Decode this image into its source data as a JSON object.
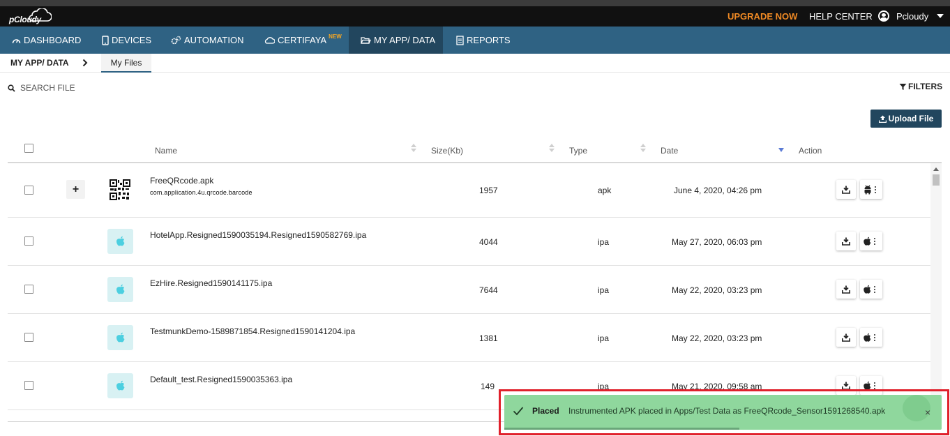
{
  "header": {
    "logo_text": "pCloudy",
    "upgrade_label": "UPGRADE NOW",
    "help_label": "HELP CENTER",
    "user_name": "Pcloudy"
  },
  "nav": {
    "items": [
      {
        "label": "DASHBOARD",
        "icon": "speedometer-icon"
      },
      {
        "label": "DEVICES",
        "icon": "mobile-icon"
      },
      {
        "label": "AUTOMATION",
        "icon": "gears-icon"
      },
      {
        "label": "CERTIFAYA",
        "icon": "cloud-cog-icon",
        "badge": "NEW"
      },
      {
        "label": "MY APP/ DATA",
        "icon": "folder-open-icon",
        "active": true
      },
      {
        "label": "REPORTS",
        "icon": "document-icon"
      }
    ]
  },
  "subbar": {
    "title": "MY APP/ DATA",
    "tab_label": "My Files"
  },
  "toolbar": {
    "search_label": "SEARCH FILE",
    "filters_label": "FILTERS",
    "upload_label": "Upload File"
  },
  "table": {
    "columns": {
      "name": "Name",
      "size": "Size(Kb)",
      "type": "Type",
      "date": "Date",
      "action": "Action"
    },
    "rows": [
      {
        "name": "FreeQRcode.apk",
        "package": "com.application.4u.qrcode.barcode",
        "size": "1957",
        "type": "apk",
        "date": "June 4, 2020, 04:26 pm",
        "platform": "android"
      },
      {
        "name": "HotelApp.Resigned1590035194.Resigned1590582769.ipa",
        "size": "4044",
        "type": "ipa",
        "date": "May 27, 2020, 06:03 pm",
        "platform": "ios"
      },
      {
        "name": "EzHire.Resigned1590141175.ipa",
        "size": "7644",
        "type": "ipa",
        "date": "May 22, 2020, 03:23 pm",
        "platform": "ios"
      },
      {
        "name": "TestmunkDemo-1589871854.Resigned1590141204.ipa",
        "size": "1381",
        "type": "ipa",
        "date": "May 22, 2020, 03:23 pm",
        "platform": "ios"
      },
      {
        "name": "Default_test.Resigned1590035363.ipa",
        "size": "149",
        "type": "ipa",
        "date": "May 21, 2020, 09:58 am",
        "platform": "ios"
      }
    ]
  },
  "toast": {
    "title": "Placed",
    "message": "Instrumented APK placed in Apps/Test Data as FreeQRcode_Sensor1591268540.apk",
    "close_label": "×",
    "color": "#8fd79d"
  },
  "colors": {
    "topbar": "#111111",
    "nav": "#2f6283",
    "nav_active": "#22465e",
    "accent_orange": "#f08a24",
    "highlight_red": "#e0202b"
  }
}
